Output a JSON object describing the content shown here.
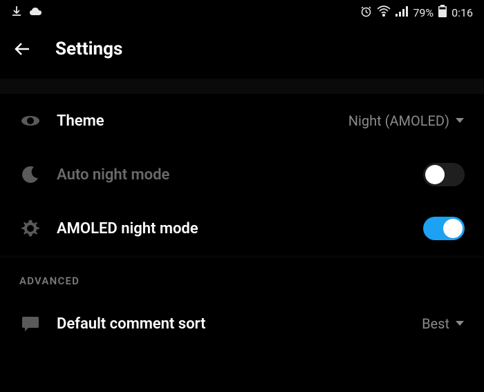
{
  "status_bar": {
    "battery_percent": "79%",
    "time": "0:16"
  },
  "header": {
    "title": "Settings"
  },
  "settings": {
    "theme": {
      "label": "Theme",
      "value": "Night (AMOLED)"
    },
    "auto_night_mode": {
      "label": "Auto night mode"
    },
    "amoled_night_mode": {
      "label": "AMOLED night mode"
    }
  },
  "sections": {
    "advanced": "ADVANCED"
  },
  "advanced_settings": {
    "default_comment_sort": {
      "label": "Default comment sort",
      "value": "Best"
    }
  }
}
